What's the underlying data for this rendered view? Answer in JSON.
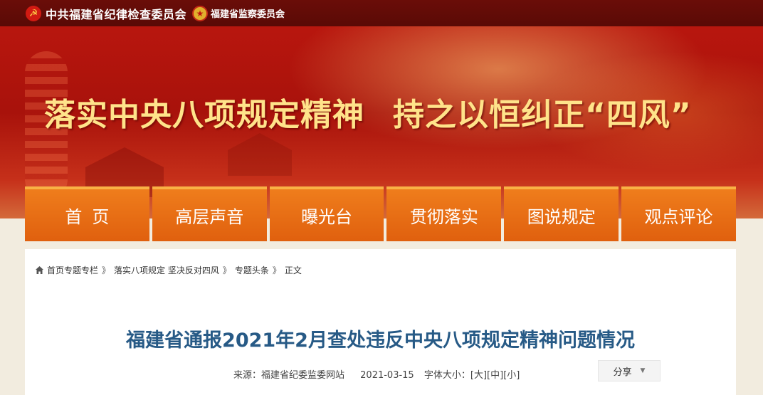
{
  "header": {
    "org_primary": "中共福建省纪律检查委员会",
    "org_secondary": "福建省监察委员会",
    "slogan_left": "落实中央八项规定精神",
    "slogan_right": "持之以恒纠正“四风”"
  },
  "nav": {
    "items": [
      "首页",
      "高层声音",
      "曝光台",
      "贯彻落实",
      "图说规定",
      "观点评论"
    ]
  },
  "breadcrumb": {
    "items": [
      "首页专题专栏",
      "落实八项规定 坚决反对四风",
      "专题头条",
      "正文"
    ],
    "separator": "》"
  },
  "article": {
    "title": "福建省通报2021年2月查处违反中央八项规定精神问题情况",
    "source": "来源：福建省纪委监委网站",
    "date": "2021-03-15",
    "font_size_label": "字体大小：",
    "size_large": "[大]",
    "size_medium": "[中]",
    "size_small": "[小]",
    "share_label": "分享"
  },
  "colors": {
    "title": "#275a86",
    "nav_bg": "#e86a12",
    "banner": "#b8160e",
    "slogan": "#ffe38a"
  },
  "icons": {
    "party_emblem": "party-emblem-icon",
    "national_emblem": "national-emblem-icon",
    "home": "home-icon",
    "share_caret": "chevron-down-icon"
  }
}
